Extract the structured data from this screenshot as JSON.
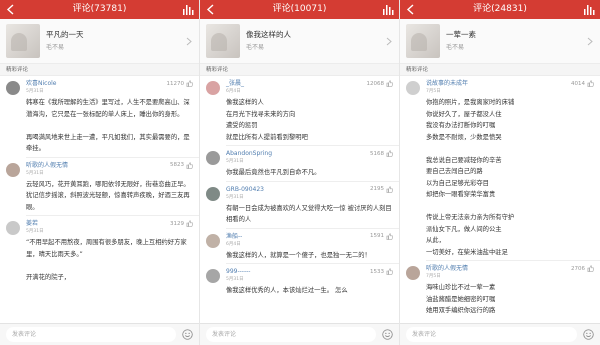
{
  "screens": [
    {
      "title": "评论(73781)",
      "song": {
        "title": "平凡的一天",
        "artist": "毛不易"
      },
      "section_label": "精彩评论",
      "comments": [
        {
          "user": "欢喜Nicole",
          "date": "5月31日",
          "likes": "11270",
          "avatar_color": "#8a8a8a",
          "text": "韩寒在《我所理解的生活》里写过，人生不是要爬高山、深潜海沟，它只是在一张标配的单人床上，睡出你的身形。\n\n再喝满风地来世上走一遭，平凡如我们，其实最需要的，是牵挂。"
        },
        {
          "user": "听歌的人假无情",
          "date": "5月31日",
          "likes": "5823",
          "avatar_color": "#b9a59a",
          "text": "云轻风巧，花开黄耳跑，哪阳依邻无限好，街巷恋曲正早。\n犹记信步摇滚，斜照波光轻颤，惊喜转声疾晚，好酒三友再眼。"
        },
        {
          "user": "姜若",
          "date": "5月31日",
          "likes": "3129",
          "avatar_color": "#c9c9c9",
          "text": "“不用早起不用熬夜，周围有很多朋友，晚上互相约好方家里，晴天比雨天多。”\n\n开满花的院子，"
        }
      ],
      "input_placeholder": "发表评论"
    },
    {
      "title": "评论(10071)",
      "song": {
        "title": "像我这样的人",
        "artist": "毛不易"
      },
      "section_label": "精彩评论",
      "comments": [
        {
          "user": "_张晨_",
          "date": "6月4日",
          "likes": "12068",
          "avatar_color": "#d9a3a3",
          "text": "像我这样的人\n在月光下找寻未来的方向\n遭受的惩罚\n就是比所有人提前看到黎明吧"
        },
        {
          "user": "AbandonSpring",
          "date": "5月31日",
          "likes": "5168",
          "avatar_color": "#9a9a9a",
          "text": "你我最后竟然也平凡到自命不凡。"
        },
        {
          "user": "GRB-090423",
          "date": "5月31日",
          "likes": "2195",
          "avatar_color": "#7f8a86",
          "text": "有朝一日会成为被喜欢的人又觉得大吃一惊 被讨厌的人刻目相看的人"
        },
        {
          "user": "渔船--",
          "date": "6月4日",
          "likes": "1591",
          "avatar_color": "#c0b1a6",
          "text": "像我这样的人，就算是一个傻子，也是独一无二的！"
        },
        {
          "user": "999------",
          "date": "5月31日",
          "likes": "1533",
          "avatar_color": "#a6a6a6",
          "text": "像我这样优秀的人，本该灿烂过一生。          怎么"
        }
      ],
      "input_placeholder": "发表评论"
    },
    {
      "title": "评论(24831)",
      "song": {
        "title": "一荤一素",
        "artist": "毛不易"
      },
      "section_label": "精彩评论",
      "comments": [
        {
          "user": "说故事的未成年",
          "date": "7月5日",
          "likes": "4014",
          "avatar_color": "#cfcfcf",
          "text": "你抱的照片，是我离家时的床铺\n你说好久了，屋子都没人住\n我没有办法打断你的叮嘱\n多数是不耐烦，少数是愤哭\n\n我总说自己要减轻你的辛苦\n要自己去闯自己的路\n以为自己足够光彩夺目\n却把你一眼看穿荣华富贵\n\n传说上帝无法亲力亲为所有守护\n派仙女下凡，做人间的公主\n从此，\n一切美好，在柴米油盐中驻足"
        },
        {
          "user": "听歌的人假无情",
          "date": "7月5日",
          "likes": "2706",
          "avatar_color": "#b9a59a",
          "text": "海味山珍比不过一荤一素\n油盐酱醋是她细密的叮嘱\n她用双手编织你远行的路"
        }
      ],
      "input_placeholder": "发表评论"
    }
  ]
}
